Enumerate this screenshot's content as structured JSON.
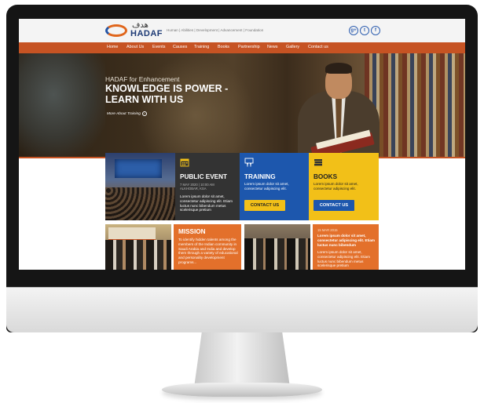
{
  "colors": {
    "accent": "#c65323",
    "blue": "#1d57ad",
    "yellow": "#f2c018",
    "dark": "#333333",
    "orange": "#e3702b"
  },
  "brand": {
    "arabic": "هدف",
    "name": "HADAF"
  },
  "tagline": "Human | Abilities | Development | Advancement | Foundation",
  "social": [
    {
      "icon": "google-plus-icon",
      "glyph": "g+"
    },
    {
      "icon": "twitter-icon",
      "glyph": "t"
    },
    {
      "icon": "facebook-icon",
      "glyph": "f"
    }
  ],
  "nav": [
    "Home",
    "About Us",
    "Events",
    "Causes",
    "Training",
    "Books",
    "Partnership",
    "News",
    "Gallery",
    "Contact us"
  ],
  "hero": {
    "subtitle": "HADAF for Enhancement",
    "title_line1": "KNOWLEDGE IS  POWER -",
    "title_line2": "LEARN WITH US",
    "link": "More About Training"
  },
  "tiles": {
    "event": {
      "icon": "calendar-icon",
      "title": "PUBLIC EVENT",
      "date1": "7 MAY 2020  |  10:00 AM",
      "date2": "ALKHOBAR, KSA",
      "text": "Lorem ipsum dolor sit amet, consectetur adipiscing elit. Etiam luctus nunc bibendum metus scelerisque pretium"
    },
    "training": {
      "icon": "presentation-icon",
      "title": "TRAINING",
      "text": "Lorem ipsum dolor sit amet, consectetur adipiscing elit.",
      "button": "CONTACT US"
    },
    "books": {
      "icon": "books-icon",
      "title": "BOOKS",
      "text": "Lorem ipsum dolor sit amet, consectetur adipiscing elit.",
      "button": "CONTACT US"
    },
    "mission": {
      "title": "MISSION",
      "text": "To identify hidden talents among the members of the Indian community in Saudi Arabia and India and develop them through a variety of educational and personality development programs..."
    },
    "news": {
      "date": "15 MAR 2015",
      "headline": "Lorem ipsum dolor sit amet, consectetur adipiscing elit. Etiam luctus nunc bibendum",
      "text": "Lorem ipsum dolor sit amet, consectetur adipiscing elit. Etiam luctus nunc bibendum metus scelerisque pretium"
    }
  }
}
